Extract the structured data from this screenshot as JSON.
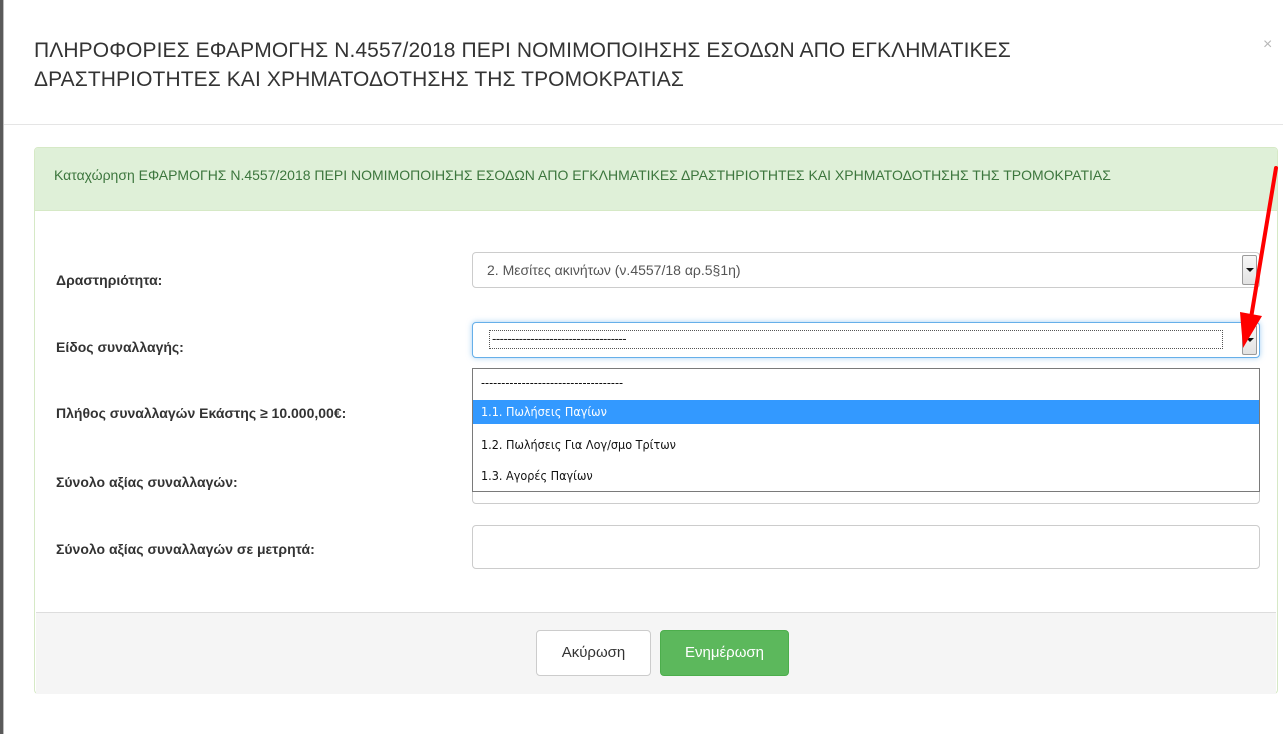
{
  "modal": {
    "title_line1": "ΠΛΗΡΟΦΟΡΙΕΣ ΕΦΑΡΜΟΓΗΣ Ν.4557/2018 ΠΕΡΙ ΝΟΜΙΜΟΠΟΙΗΣΗΣ ΕΣΟΔΩΝ ΑΠΟ ΕΓΚΛΗΜΑΤΙΚΕΣ",
    "title_line2": "ΔΡΑΣΤΗΡΙΟΤΗΤΕΣ ΚΑΙ ΧΡΗΜΑΤΟΔΟΤΗΣΗΣ ΤΗΣ ΤΡΟΜΟΚΡΑΤΙΑΣ",
    "close_label": "×"
  },
  "panel": {
    "heading": "Καταχώρηση ΕΦΑΡΜΟΓΗΣ Ν.4557/2018 ΠΕΡΙ ΝΟΜΙΜΟΠΟΙΗΣΗΣ ΕΣΟΔΩΝ ΑΠΟ ΕΓΚΛΗΜΑΤΙΚΕΣ ΔΡΑΣΤΗΡΙΟΤΗΤΕΣ ΚΑΙ ΧΡΗΜΑΤΟΔΟΤΗΣΗΣ ΤΗΣ ΤΡΟΜΟΚΡΑΤΙΑΣ"
  },
  "form": {
    "activity_label": "Δραστηριότητα:",
    "activity_value": "2. Μεσίτες ακινήτων (ν.4557/18 αρ.5§1η)",
    "transaction_type_label": "Είδος συναλλαγής:",
    "transaction_type_value": "-----------------------------------",
    "count_label": "Πλήθος συναλλαγών Εκάστης ≥ 10.000,00€:",
    "total_value_label": "Σύνολο αξίας συναλλαγών:",
    "total_cash_label": "Σύνολο αξίας συναλλαγών σε μετρητά:",
    "total_cash_value": ""
  },
  "dropdown": {
    "options": [
      "-----------------------------------",
      "1.1. Πωλήσεις Παγίων",
      "1.2. Πωλήσεις Για Λογ/σμο Τρίτων",
      "1.3. Αγορές Παγίων"
    ],
    "selected_index": 1
  },
  "footer": {
    "cancel_label": "Ακύρωση",
    "update_label": "Ενημέρωση"
  },
  "colors": {
    "panel_heading_bg": "#dff0d8",
    "panel_heading_text": "#3c763d",
    "selected_option_bg": "#3399ff",
    "update_button_bg": "#5cb85c",
    "annotation_arrow": "#ff0000"
  }
}
